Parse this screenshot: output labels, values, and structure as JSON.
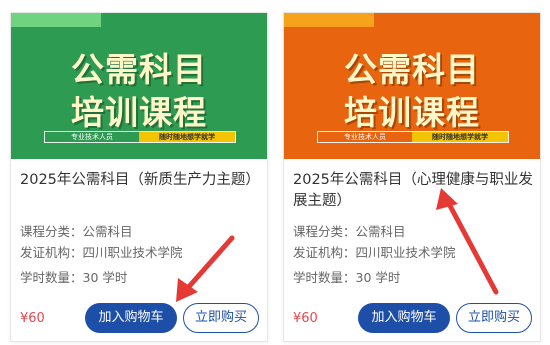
{
  "cards": [
    {
      "banner_line1": "公需科目",
      "banner_line2": "培训课程",
      "banner_left": "专业技术人员",
      "banner_right": "随时随地想学就学",
      "banner_color": "#2e9b52",
      "stripe_color": "#6fd37f",
      "title": "2025年公需科目（新质生产力主题）",
      "category": "课程分类：公需科目",
      "issuer": "发证机构：四川职业技术学院",
      "hours": "学时数量：30 学时",
      "price": "¥60",
      "cart_label": "加入购物车",
      "buy_label": "立即购买"
    },
    {
      "banner_line1": "公需科目",
      "banner_line2": "培训课程",
      "banner_left": "专业技术人员",
      "banner_right": "随时随地想学就学",
      "banner_color": "#e8640e",
      "stripe_color": "#f6a21b",
      "title": "2025年公需科目（心理健康与职业发展主题）",
      "category": "课程分类：公需科目",
      "issuer": "发证机构：四川职业技术学院",
      "hours": "学时数量：30 学时",
      "price": "¥60",
      "cart_label": "加入购物车",
      "buy_label": "立即购买"
    }
  ],
  "annotation_color": "#e53935"
}
